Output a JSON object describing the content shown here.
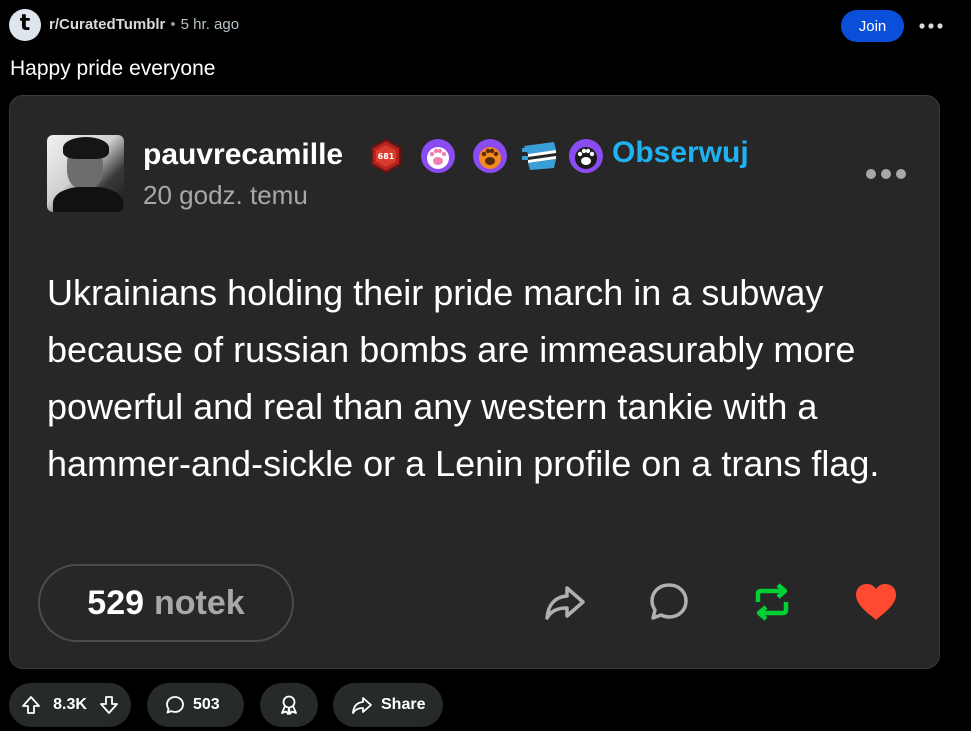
{
  "header": {
    "subreddit": "r/CuratedTumblr",
    "separator": "•",
    "time_ago": "5 hr. ago",
    "join_label": "Join",
    "subreddit_icon_glyph": "t"
  },
  "post": {
    "title": "Happy pride everyone"
  },
  "tumblr": {
    "author": "pauvrecamille",
    "badge_icons": [
      "hexagon-badge-icon",
      "pink-paw-badge-icon",
      "orange-paw-badge-icon",
      "teeth-badge-icon",
      "black-paw-badge-icon"
    ],
    "badge_text": "681",
    "follow_label": "Obserwuj",
    "time": "20 godz. temu",
    "body": "Ukrainians holding their pride march in a subway because of russian bombs are immeasurably more powerful and real than any western tankie with a hammer-and-sickle or a Lenin profile on a trans flag.",
    "notes_count": "529",
    "notes_label": "notek",
    "colors": {
      "follow": "#1fb1f0",
      "reblog": "#00cf35",
      "like": "#ff4930",
      "join": "#0a4fd9"
    }
  },
  "footer": {
    "vote_count": "8.3K",
    "comment_count": "503",
    "share_label": "Share"
  }
}
